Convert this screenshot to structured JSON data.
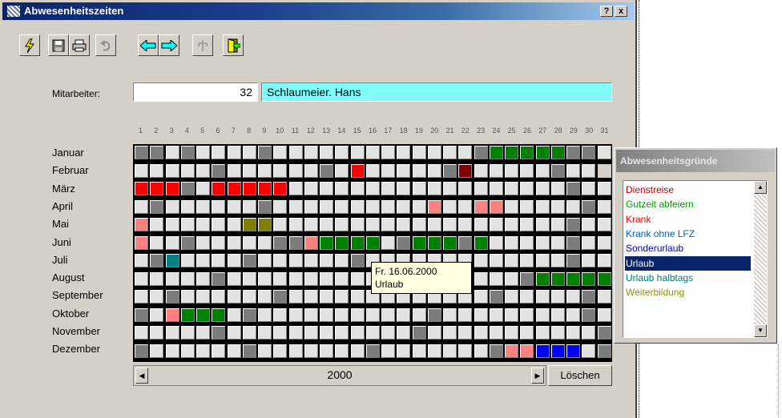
{
  "window": {
    "title": "Abwesenheitszeiten",
    "help_button": "?",
    "close_button": "x"
  },
  "toolbar": {
    "icons": [
      "lightning-icon",
      "save-icon",
      "print-icon",
      "undo-icon",
      "arrow-left-icon",
      "arrow-right-icon",
      "tree-icon",
      "exit-door-icon"
    ]
  },
  "employee": {
    "label": "Mitarbeiter:",
    "number": "32",
    "name": "Schlaumeier. Hans"
  },
  "days": [
    "1",
    "2",
    "3",
    "4",
    "5",
    "6",
    "7",
    "8",
    "9",
    "10",
    "11",
    "12",
    "13",
    "14",
    "15",
    "16",
    "17",
    "18",
    "19",
    "20",
    "21",
    "22",
    "23",
    "24",
    "25",
    "26",
    "27",
    "28",
    "29",
    "30",
    "31"
  ],
  "months": [
    "Januar",
    "Februar",
    "März",
    "April",
    "Mai",
    "Juni",
    "Juli",
    "August",
    "September",
    "Oktober",
    "November",
    "Dezember"
  ],
  "colors": {
    "empty": "#e2e2e2",
    "weekend": "#7c7c7c",
    "red": "#ff0000",
    "darkred": "#800000",
    "green": "#008000",
    "salmon": "#ff8080",
    "olive": "#808000",
    "teal": "#008080",
    "blue": "#0000ff",
    "selection": "#0a246a"
  },
  "calendar": [
    "WWEWEEEEWEEEEEEEEEEEEEWGGGGGWWE",
    "EEEEEWEEEEEEWEREEEEEWDEEEEEWEEX",
    "RRRWERRRRREEEEEEEEEEEEEEEEEEWEE",
    "EWEEEEEEWEEEEEEEEEESEESSEEEEEWE",
    "SEEEEEEOOEEEEEEEEEEEEEEEEEEEWEE",
    "SEEWEEEEEWWSGGGGEWGGGWGEEEEEWEE",
    "EWTEEEEWEEEEEEWEEEEEEEEEEEEEWEE",
    "EEEEEWEEEEEEEEEEEEEEEEEEEWGGGGG",
    "EEWEEEEEEWEEEEEEEEEEEEEWEEEEEWE",
    "WESGGGEWEEEEEEEEEEEWEEEEEEEEEWE",
    "EEEEEWEEEEEEEEEEEEWEEEEEEEEEEEW",
    "WEEEEEEWEEEEEEEWEEEEEEEWSSBBBEW"
  ],
  "tooltip": {
    "date": "Fr. 16.06.2000",
    "reason": "Urlaub"
  },
  "year": "2000",
  "delete_button": "Löschen",
  "reasons_panel": {
    "title": "Abwesenheitsgründe",
    "items": [
      {
        "label": "Dienstreise",
        "color": "#c00000"
      },
      {
        "label": "Gutzeit abfeiern",
        "color": "#00a000"
      },
      {
        "label": "Krank",
        "color": "#ff0000"
      },
      {
        "label": "Krank ohne LFZ",
        "color": "#0060c0"
      },
      {
        "label": "Sonderurlaub",
        "color": "#0000c0"
      },
      {
        "label": "Urlaub",
        "color": "#ffffff",
        "selected": true
      },
      {
        "label": "Urlaub halbtags",
        "color": "#008080"
      },
      {
        "label": "Weiterbildung",
        "color": "#909000"
      }
    ]
  }
}
